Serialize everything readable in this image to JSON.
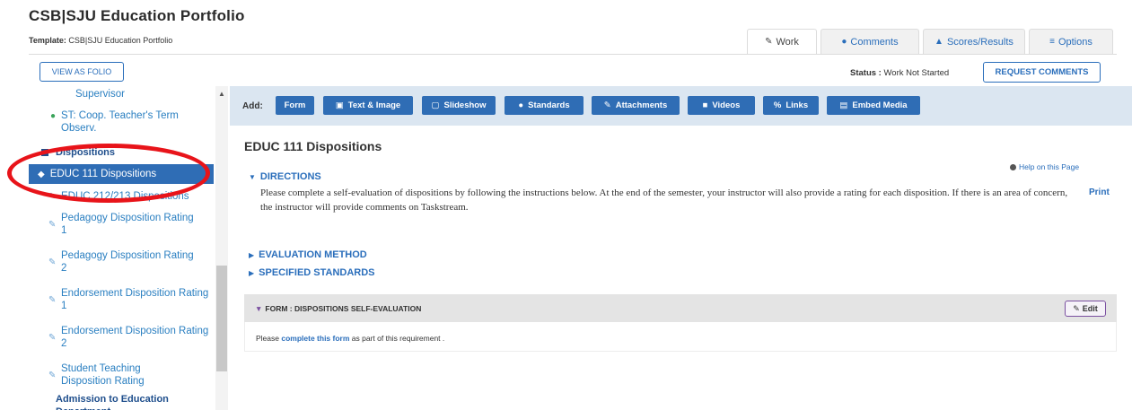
{
  "header": {
    "title": "CSB|SJU Education Portfolio",
    "template_label": "Template:",
    "template_value": "CSB|SJU Education Portfolio"
  },
  "tabs": [
    {
      "label": "Work",
      "icon": "edit-icon"
    },
    {
      "label": "Comments",
      "icon": "comments-icon"
    },
    {
      "label": "Scores/Results",
      "icon": "chart-icon"
    },
    {
      "label": "Options",
      "icon": "menu-icon"
    }
  ],
  "toolbar": {
    "view_folio": "VIEW AS FOLIO",
    "status_label": "Status :",
    "status_value": "Work Not Started",
    "request_comments": "REQUEST COMMENTS"
  },
  "sidebar": {
    "partial_item": "Supervisor",
    "st_item": "ST: Coop. Teacher's Term Observ.",
    "section_dispositions": "Dispositions",
    "active_item": "EDUC 111 Dispositions",
    "items": [
      "EDUC 212/213 Dispositions",
      "Pedagogy Disposition Rating 1",
      "Pedagogy Disposition Rating 2",
      "Endorsement Disposition Rating 1",
      "Endorsement Disposition Rating 2",
      "Student Teaching Disposition Rating"
    ],
    "section_admission": "Admission to Education Department"
  },
  "addbar": {
    "label": "Add:",
    "buttons": [
      "Form",
      "Text & Image",
      "Slideshow",
      "Standards",
      "Attachments",
      "Videos",
      "Links",
      "Embed Media"
    ]
  },
  "main": {
    "title": "EDUC 111 Dispositions",
    "help": "Help on this Page",
    "directions": "DIRECTIONS",
    "directions_text": "Please complete a self-evaluation of dispositions by following the instructions below. At the end of the semester, your instructor will also provide a rating for each disposition. If there is an area of concern, the instructor will provide comments on Taskstream.",
    "print": "Print",
    "evaluation_method": "EVALUATION METHOD",
    "specified_standards": "SPECIFIED STANDARDS",
    "form_title": "FORM : DISPOSITIONS SELF-EVALUATION",
    "edit": "Edit",
    "form_text_before": "Please",
    "form_link": "complete this form",
    "form_text_after": "as part of this requirement ."
  },
  "colors": {
    "accent": "#2f6db5",
    "link": "#2a6ebb",
    "highlight_oval": "#e8141a",
    "addbar_bg": "#dbe6f1"
  }
}
